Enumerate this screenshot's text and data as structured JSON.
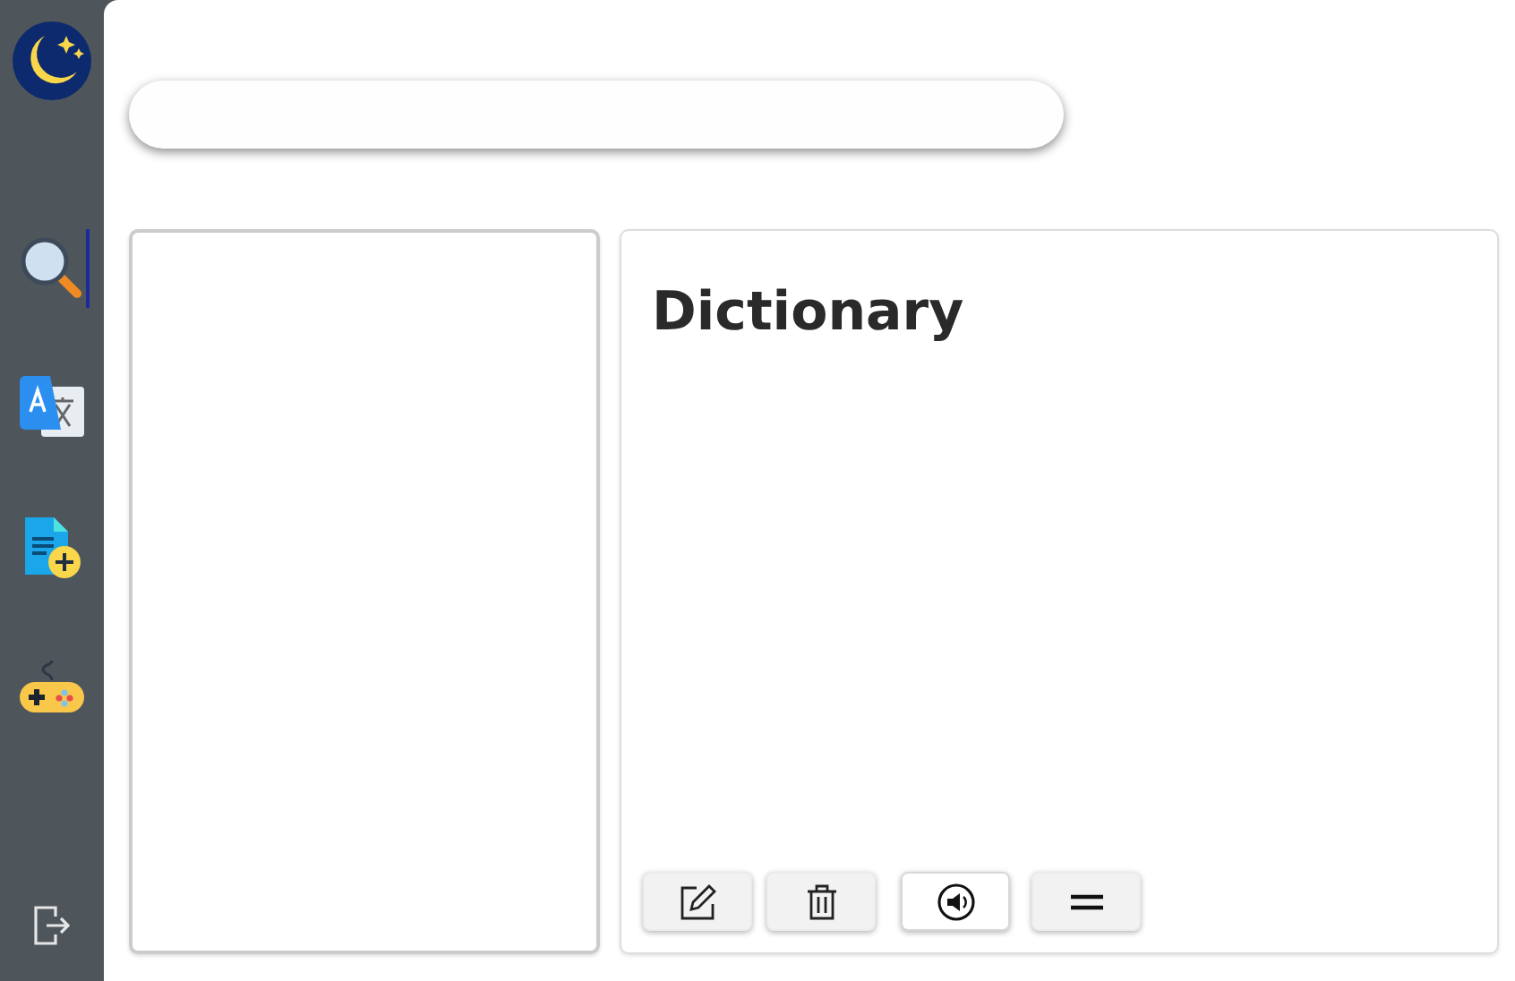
{
  "sidebar": {
    "items": [
      {
        "kind": "search",
        "selected": true
      },
      {
        "kind": "translate",
        "selected": false
      },
      {
        "kind": "new-document",
        "selected": false
      },
      {
        "kind": "game",
        "selected": false
      }
    ]
  },
  "dictionary": {
    "title": "Dictionary",
    "buttons": [
      {
        "kind": "edit",
        "active": false
      },
      {
        "kind": "delete",
        "active": false
      },
      {
        "kind": "sound",
        "active": true
      },
      {
        "kind": "menu",
        "active": false
      }
    ]
  }
}
